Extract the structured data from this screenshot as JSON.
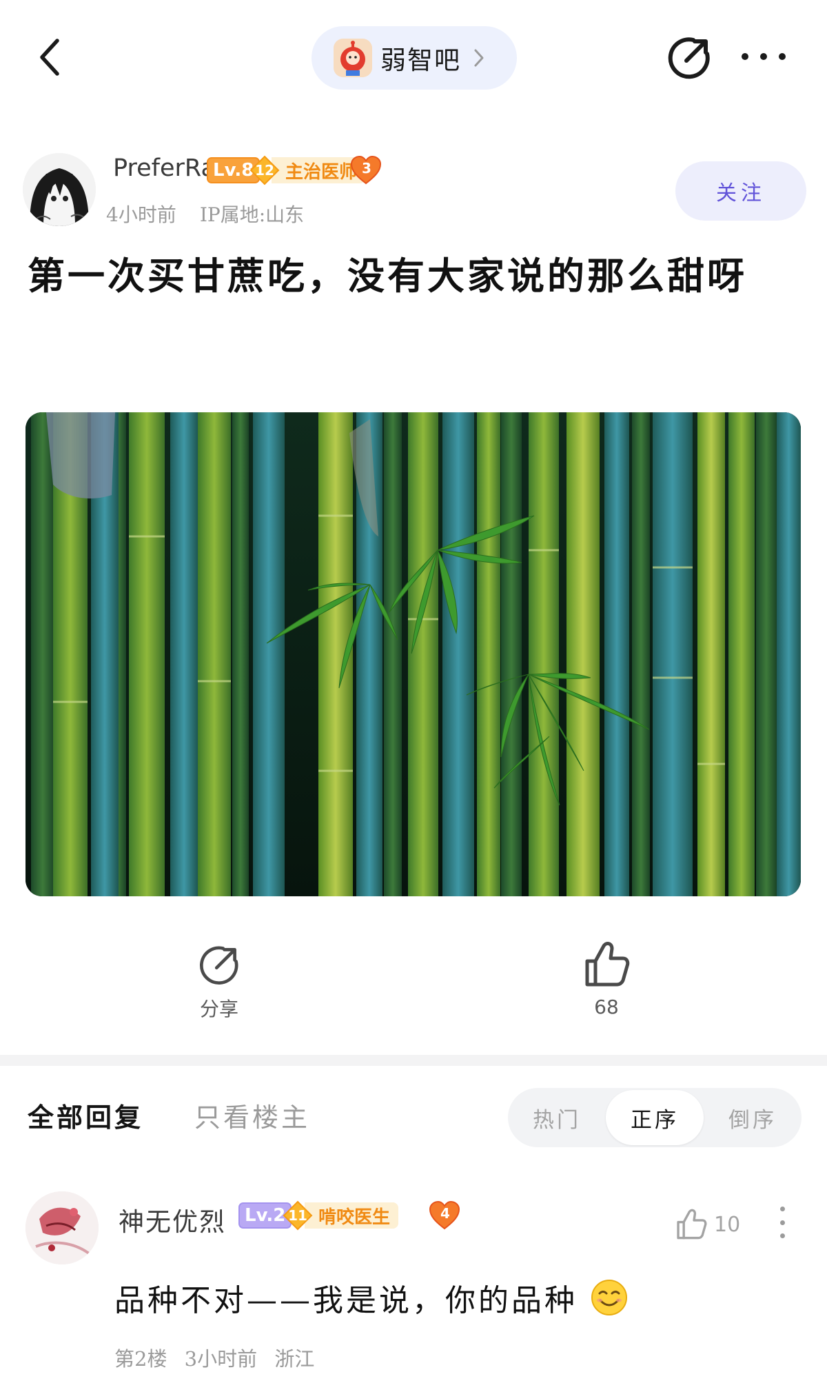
{
  "nav": {
    "forum_name": "弱智吧",
    "icons": {
      "back": "chevron-left-icon",
      "forum_enter": "chevron-right-icon",
      "share": "share-icon",
      "more": "more-horizontal-icon"
    }
  },
  "author": {
    "name": "PreferRain",
    "level": "Lv.8",
    "title_level": "12",
    "title": "主治医师",
    "heart_count": "3",
    "time": "4小时前",
    "ip": "IP属地:山东",
    "follow_label": "关注"
  },
  "post": {
    "title": "第一次买甘蔗吃，没有大家说的那么甜呀",
    "image_subject": "bamboo stalks with leaves"
  },
  "actions": {
    "share_label": "分享",
    "like_count": "68"
  },
  "replies": {
    "tab_all": "全部回复",
    "tab_op_only": "只看楼主",
    "sort_options": [
      "热门",
      "正序",
      "倒序"
    ],
    "sort_selected": "正序"
  },
  "comment": {
    "user": "神无优烈",
    "level": "Lv.2",
    "title_level": "11",
    "title": "啃咬医生",
    "heart_count": "4",
    "like_count": "10",
    "text": "品种不对——我是说，你的品种",
    "floor": "第2楼",
    "time": "3小时前",
    "location": "浙江"
  },
  "colors": {
    "accent_purple": "#6153d9",
    "follow_bg": "#edeefc",
    "pill_bg": "#edf1fd",
    "level_orange": "#f9a23b",
    "level_purple": "#b9a9f4",
    "title_badge_text": "#f08a13",
    "muted_text": "#9a9a9a"
  }
}
